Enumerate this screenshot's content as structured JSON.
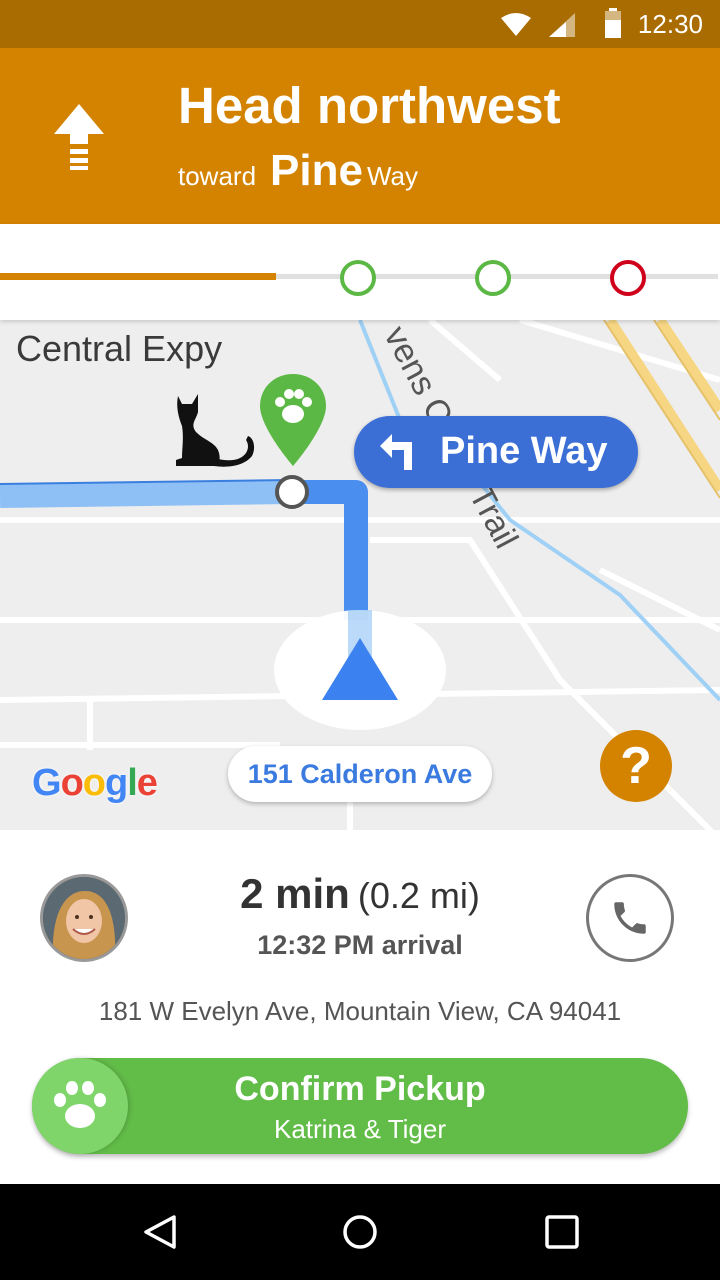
{
  "status_bar": {
    "time": "12:30"
  },
  "instruction": {
    "title": "Head northwest",
    "toward": "toward",
    "street_main": "Pine",
    "street_suffix": "Way"
  },
  "map": {
    "street_label_1": "Central Expy",
    "street_label_2": "vens Creek Trail",
    "turn_chip": "Pine Way",
    "current_address": "151 Calderon Ave",
    "help": "?",
    "brand": [
      "G",
      "o",
      "o",
      "g",
      "l",
      "e"
    ]
  },
  "trip": {
    "eta_minutes": "2 min",
    "distance": "(0.2 mi)",
    "arrival": "12:32 PM arrival",
    "address": "181 W Evelyn Ave, Mountain View, CA 94041"
  },
  "confirm": {
    "title": "Confirm Pickup",
    "subtitle": "Katrina & Tiger"
  },
  "colors": {
    "status_bar": "#a96c00",
    "header": "#d38300",
    "route": "#4a8ff0",
    "confirm": "#62bc48",
    "stop_green": "#5cb845",
    "stop_red": "#d0021b"
  }
}
